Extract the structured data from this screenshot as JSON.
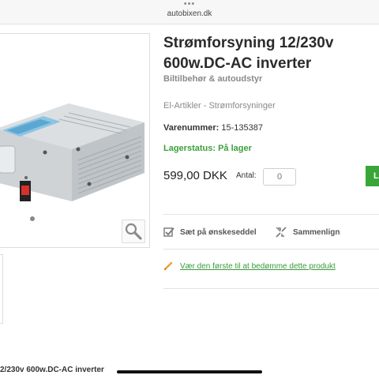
{
  "browser": {
    "dots": "•••",
    "url": "autobixen.dk"
  },
  "product": {
    "title": "Strømforsyning 12/230v 600w.DC-AC inverter",
    "subtitle": "Biltilbehør & autoudstyr",
    "category": "El-Artikler - Strømforsyninger",
    "sku_label": "Varenummer:",
    "sku_value": "15-135387",
    "stock": "Lagerstatus: På lager",
    "price": "599,00 DKK",
    "qty_label": "Antal:",
    "qty_value": "0",
    "buy_label": "L"
  },
  "actions": {
    "wishlist": "Sæt på ønskeseddel",
    "compare": "Sammenlign",
    "review": "Vær den første til at bedømme dette produkt"
  },
  "footer": {
    "title": "2/230v 600w.DC-AC inverter"
  },
  "colors": {
    "accent_green": "#3aa63a",
    "text_gray": "#8a8a8a",
    "review_icon": "#e8a33a"
  },
  "icons": {
    "zoom": "magnifier-icon",
    "wishlist": "checkbox-icon",
    "compare": "compare-arrows-icon",
    "review": "pencil-icon"
  }
}
